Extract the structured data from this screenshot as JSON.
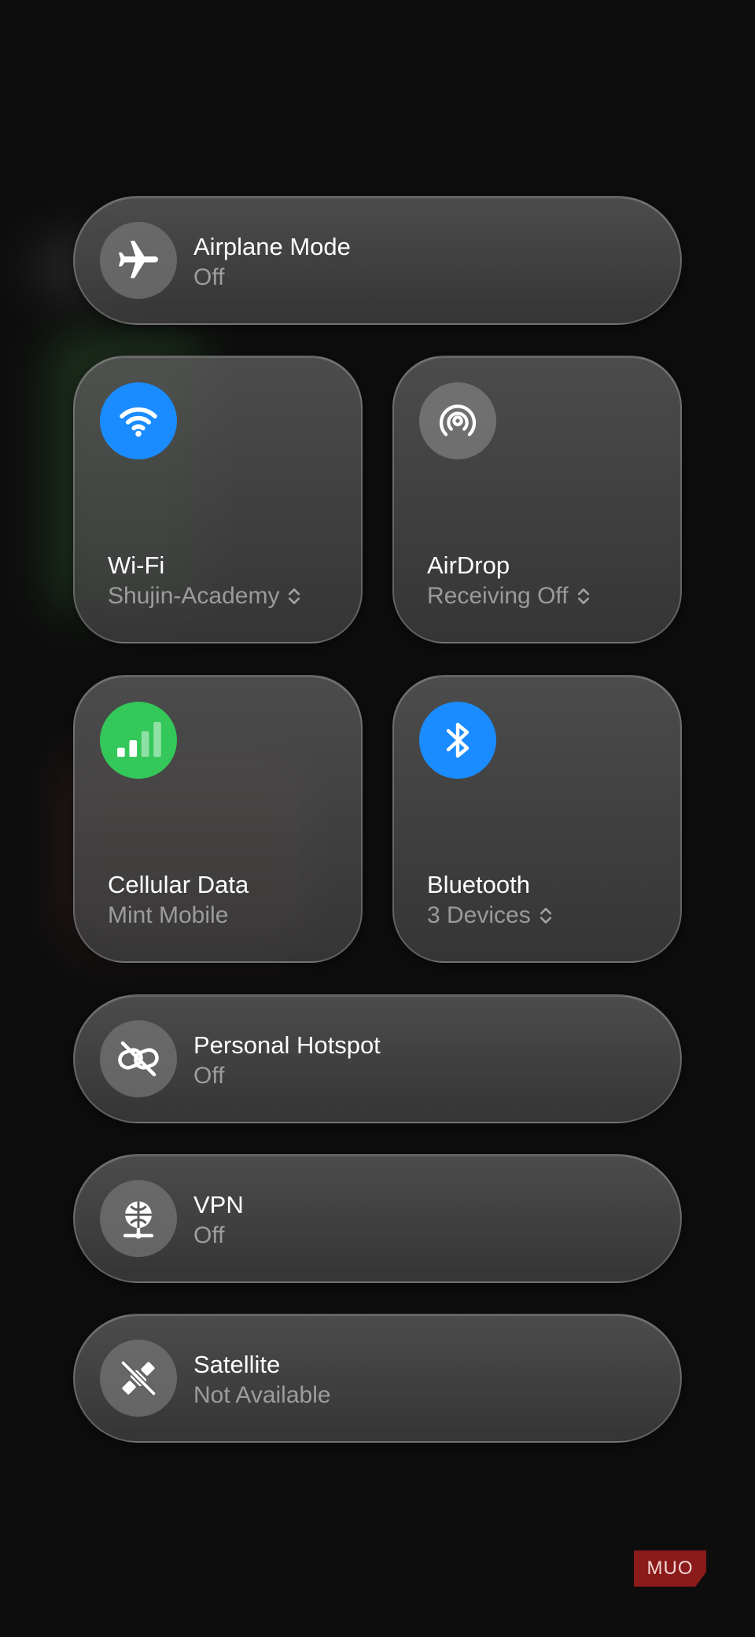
{
  "airplane": {
    "title": "Airplane Mode",
    "status": "Off"
  },
  "wifi": {
    "title": "Wi-Fi",
    "status": "Shujin-Academy"
  },
  "airdrop": {
    "title": "AirDrop",
    "status": "Receiving Off"
  },
  "cellular": {
    "title": "Cellular Data",
    "status": "Mint Mobile"
  },
  "bluetooth": {
    "title": "Bluetooth",
    "status": "3 Devices"
  },
  "hotspot": {
    "title": "Personal Hotspot",
    "status": "Off"
  },
  "vpn": {
    "title": "VPN",
    "status": "Off"
  },
  "satellite": {
    "title": "Satellite",
    "status": "Not Available"
  },
  "watermark": {
    "text": "MUO"
  },
  "icons": {
    "airplane": "airplane-icon",
    "wifi": "wifi-icon",
    "airdrop": "airdrop-icon",
    "cellular": "cellular-bars-icon",
    "bluetooth": "bluetooth-icon",
    "hotspot": "hotspot-link-off-icon",
    "vpn": "vpn-globe-icon",
    "satellite": "satellite-off-icon"
  },
  "colors": {
    "active_blue": "#1a8cff",
    "active_green": "#34c759",
    "background": "#0d0d0d",
    "watermark": "#8b1a1a"
  }
}
